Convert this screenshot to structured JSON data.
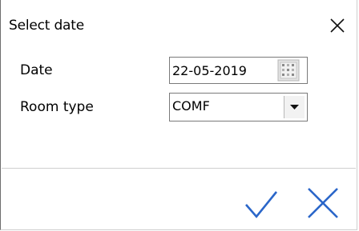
{
  "dialog": {
    "title": "Select date",
    "close_icon": "close-icon"
  },
  "form": {
    "date_label": "Date",
    "date_value": "22-05-2019",
    "calendar_icon": "calendar-icon",
    "room_type_label": "Room type",
    "room_type_value": "COMF",
    "dropdown_icon": "chevron-down-icon"
  },
  "actions": {
    "ok_icon": "checkmark-icon",
    "cancel_icon": "cancel-x-icon"
  },
  "colors": {
    "accent": "#2a66c9",
    "text": "#000000",
    "border": "#7a7a7a"
  }
}
